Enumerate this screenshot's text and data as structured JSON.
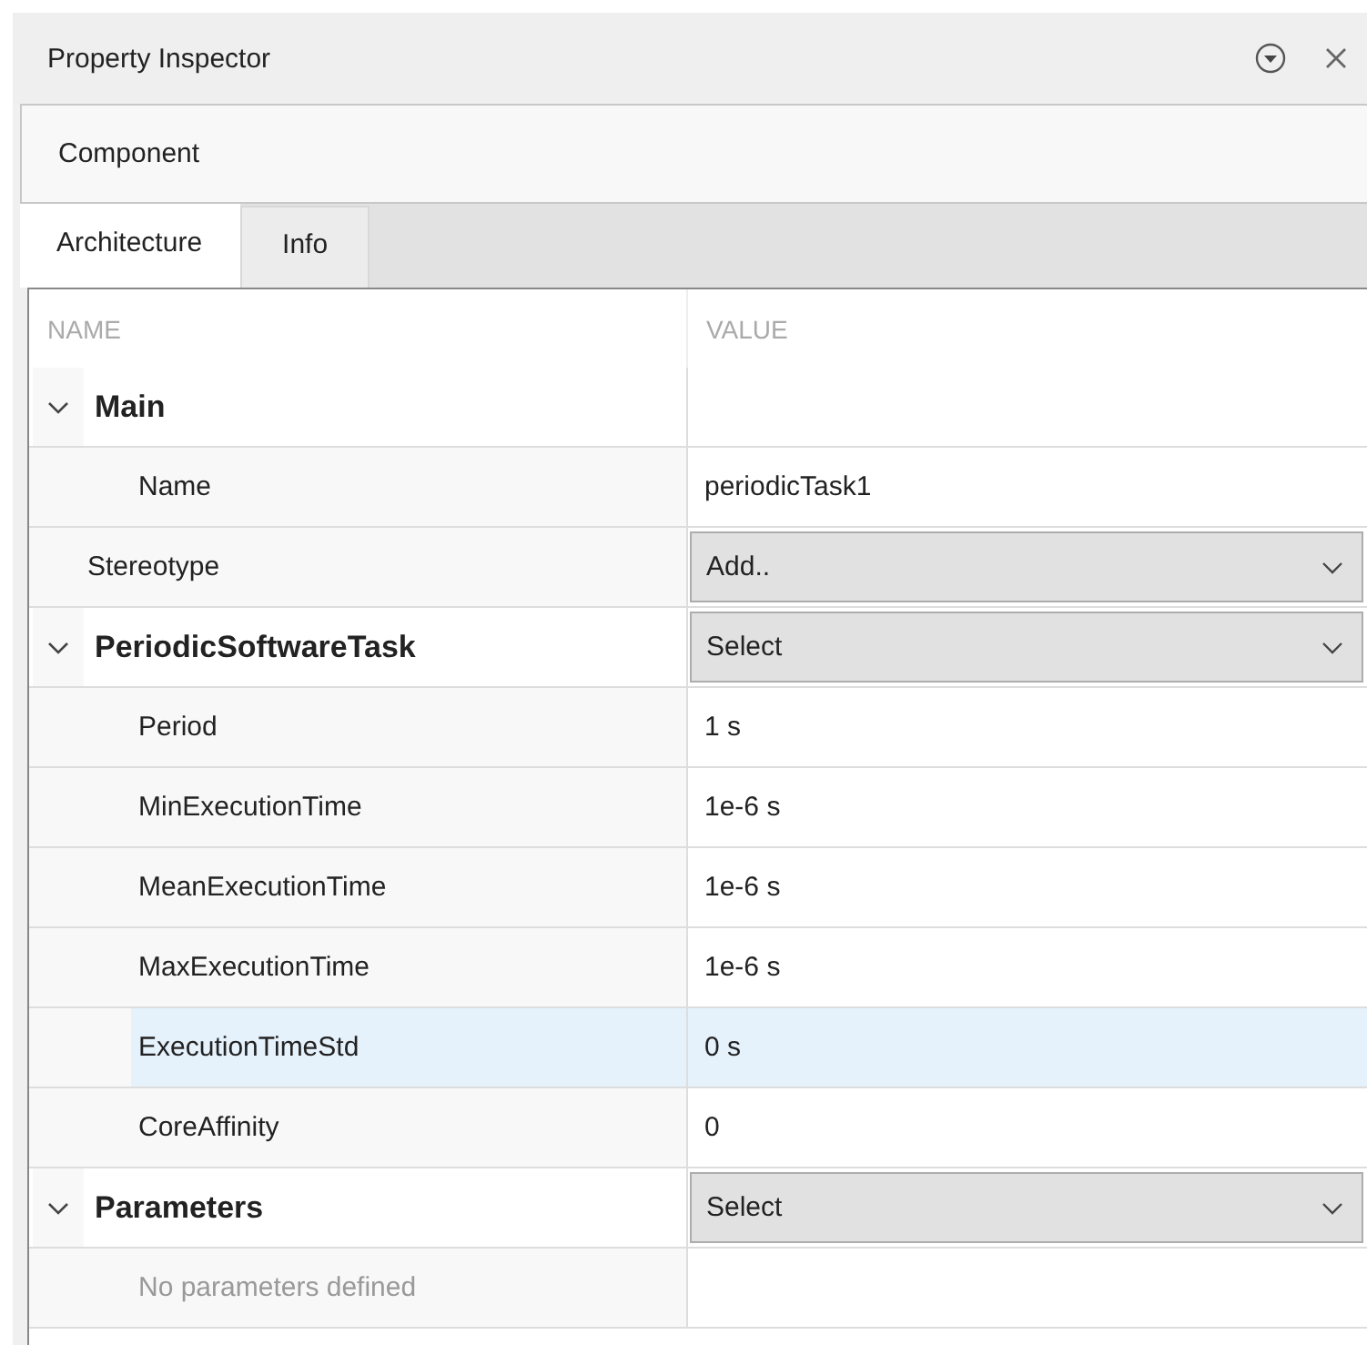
{
  "panel": {
    "title": "Property Inspector"
  },
  "breadcrumb": "Component",
  "tabs": [
    {
      "label": "Architecture",
      "selected": true
    },
    {
      "label": "Info",
      "selected": false
    }
  ],
  "table": {
    "columns": [
      "NAME",
      "VALUE"
    ],
    "rows": [
      {
        "kind": "group",
        "label": "Main",
        "expanded": true,
        "children": [
          {
            "kind": "property",
            "label": "Name",
            "value": "periodicTask1",
            "selected": false
          }
        ]
      },
      {
        "kind": "property",
        "label": "Stereotype",
        "dropdown": "Add..",
        "selected": false
      },
      {
        "kind": "group",
        "label": "PeriodicSoftwareTask",
        "expanded": true,
        "dropdown": "Select",
        "children": [
          {
            "kind": "property",
            "label": "Period",
            "value": "1 s",
            "selected": false
          },
          {
            "kind": "property",
            "label": "MinExecutionTime",
            "value": "1e-6 s",
            "selected": false
          },
          {
            "kind": "property",
            "label": "MeanExecutionTime",
            "value": "1e-6 s",
            "selected": false
          },
          {
            "kind": "property",
            "label": "MaxExecutionTime",
            "value": "1e-6 s",
            "selected": false
          },
          {
            "kind": "property",
            "label": "ExecutionTimeStd",
            "value": "0 s",
            "selected": true
          },
          {
            "kind": "property",
            "label": "CoreAffinity",
            "value": "0",
            "selected": false
          }
        ]
      },
      {
        "kind": "group",
        "label": "Parameters",
        "expanded": true,
        "dropdown": "Select",
        "children": [
          {
            "kind": "empty",
            "label": "No parameters defined"
          }
        ]
      }
    ]
  }
}
